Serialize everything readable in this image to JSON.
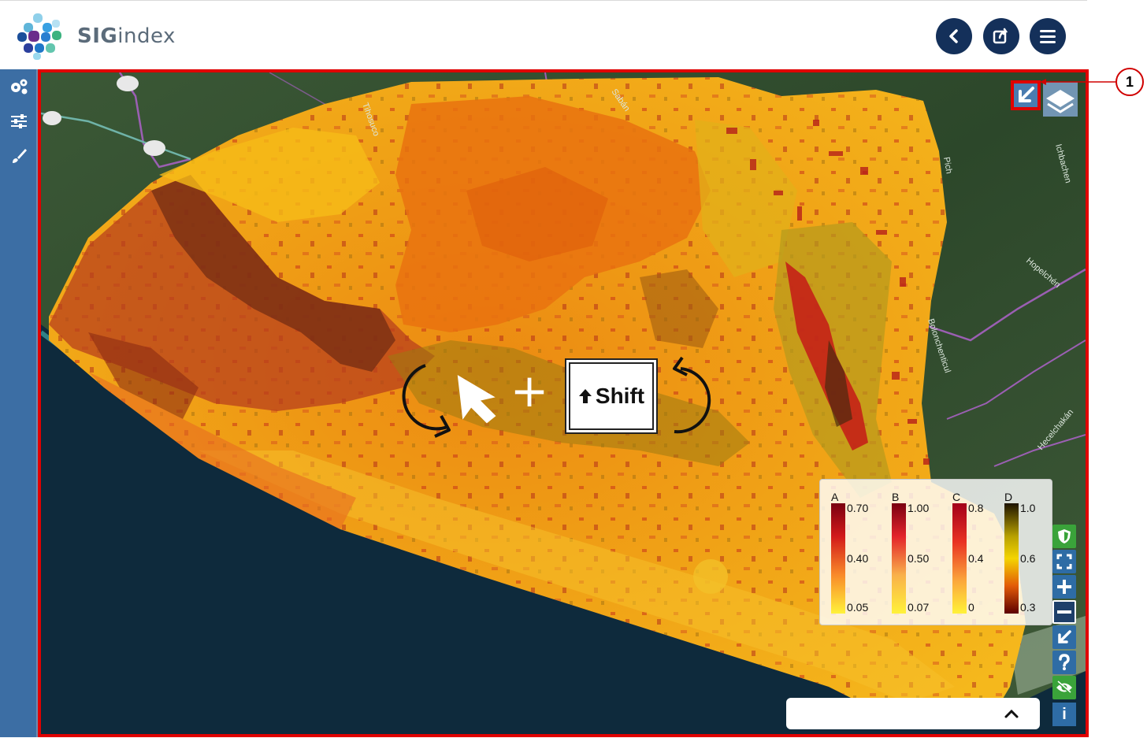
{
  "header": {
    "brand_light": "SIG",
    "brand_rest": "index"
  },
  "header_buttons": [
    {
      "name": "back-button",
      "icon": "chevron-left-icon"
    },
    {
      "name": "share-button",
      "icon": "share-icon"
    },
    {
      "name": "menu-button",
      "icon": "hamburger-icon"
    }
  ],
  "sidebar": [
    {
      "name": "settings-button",
      "icon": "gears-icon"
    },
    {
      "name": "filters-button",
      "icon": "sliders-icon"
    },
    {
      "name": "style-button",
      "icon": "brush-icon"
    }
  ],
  "map_labels": {
    "tihosuco": "Tihosuco",
    "saban": "Sabán",
    "hopelchen": "Hopelchén",
    "bolonchen": "Bolonchenticul",
    "hecelchakan": "Hecelchakán",
    "pich": "Pich",
    "chichen": "Ichbachen"
  },
  "gesture": {
    "plus": "+",
    "shift_label": "Shift"
  },
  "legend": [
    {
      "letter": "A",
      "max": "0.70",
      "mid": "0.40",
      "min": "0.05",
      "colors": [
        "#7a0010",
        "#d21a1a",
        "#f98a2a",
        "#fff23a"
      ]
    },
    {
      "letter": "B",
      "max": "1.00",
      "mid": "0.50",
      "min": "0.07",
      "colors": [
        "#7a0010",
        "#e3242b",
        "#f9b04a",
        "#fff23a"
      ]
    },
    {
      "letter": "C",
      "max": "0.8",
      "mid": "0.4",
      "min": "0",
      "colors": [
        "#a3001a",
        "#e93223",
        "#fba63b",
        "#fff23a"
      ]
    },
    {
      "letter": "D",
      "max": "1.0",
      "mid": "0.6",
      "min": "0.3",
      "colors": [
        "#1d1300",
        "#b8a100",
        "#f4d400",
        "#e25b08",
        "#5c0000"
      ]
    }
  ],
  "map_controls": [
    {
      "name": "shield-button",
      "icon": "shield-icon",
      "style": "green"
    },
    {
      "name": "fullscreen-button",
      "icon": "fullscreen-icon",
      "style": "blue"
    },
    {
      "name": "zoom-in-button",
      "icon": "plus-icon",
      "style": "blue"
    },
    {
      "name": "zoom-out-button",
      "icon": "minus-icon",
      "style": "dark"
    },
    {
      "name": "reset-rotation-button",
      "icon": "arrow-down-left-icon",
      "style": "blue"
    },
    {
      "name": "help-button",
      "icon": "question-icon",
      "style": "blue"
    },
    {
      "name": "visibility-button",
      "icon": "eye-slash-icon",
      "style": "green"
    }
  ],
  "info_button": "i",
  "callout": "1",
  "colors": {
    "frame": "#e00000",
    "header_buttons": "#14305a",
    "sidebar": "#3c6ea4",
    "ocean": "#0e2a3c",
    "land": "#2e4a2a"
  }
}
